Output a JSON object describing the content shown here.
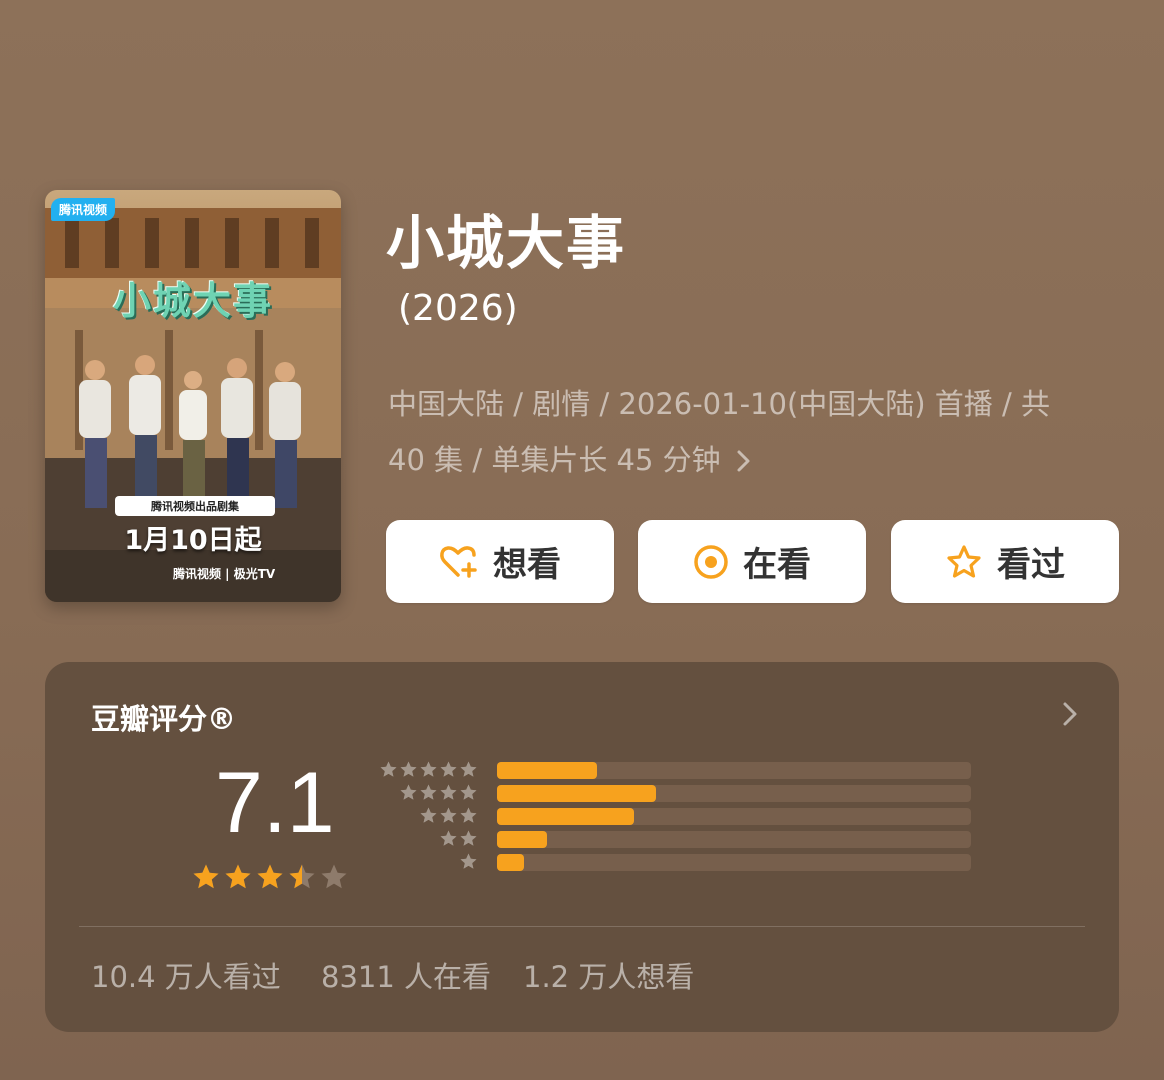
{
  "poster": {
    "badge": "腾讯视频",
    "title": "小城大事",
    "ribbon": "腾讯视频出品剧集",
    "date": "1月10日起",
    "platform": "腾讯视频 | 极光TV"
  },
  "title": "小城大事",
  "year": "(2026)",
  "meta_line1": "中国大陆 / 剧情 / 2026-01-10(中国大陆) 首播 / 共",
  "meta_line2": "40 集 / 单集片长 45 分钟",
  "actions": {
    "want": "想看",
    "doing": "在看",
    "done": "看过"
  },
  "rating": {
    "label": "豆瓣评分®",
    "score": "7.1",
    "stars_filled": 3.5,
    "distribution": [
      {
        "stars": 5,
        "fraction": 0.21
      },
      {
        "stars": 4,
        "fraction": 0.335
      },
      {
        "stars": 3,
        "fraction": 0.29
      },
      {
        "stars": 2,
        "fraction": 0.105
      },
      {
        "stars": 1,
        "fraction": 0.058
      }
    ]
  },
  "stats": {
    "seen": "10.4 万人看过",
    "watching": "8311 人在看",
    "want": "1.2 万人想看"
  },
  "colors": {
    "accent": "#f7a21e",
    "background": "#8a6e57",
    "card": "#64503f"
  },
  "icons": [
    "heart-plus-icon",
    "target-icon",
    "star-outline-icon",
    "chevron-right-icon",
    "star-icon"
  ]
}
